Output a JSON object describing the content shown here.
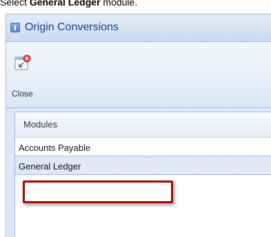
{
  "instruction": {
    "prefix": "Select ",
    "bold": "General Ledger",
    "suffix": " module."
  },
  "window": {
    "title": "Origin Conversions",
    "title_icon": "window-app-icon"
  },
  "toolbar": {
    "close_label": "Close",
    "close_icon": "close-icon"
  },
  "grid": {
    "header": "Modules",
    "rows": [
      "Accounts Payable",
      "General Ledger"
    ],
    "selected_index": 1
  },
  "colors": {
    "highlight_border": "#b40000",
    "panel_bg": "#dfe8f6",
    "panel_border": "#99bbe8",
    "title_text": "#15428b"
  }
}
